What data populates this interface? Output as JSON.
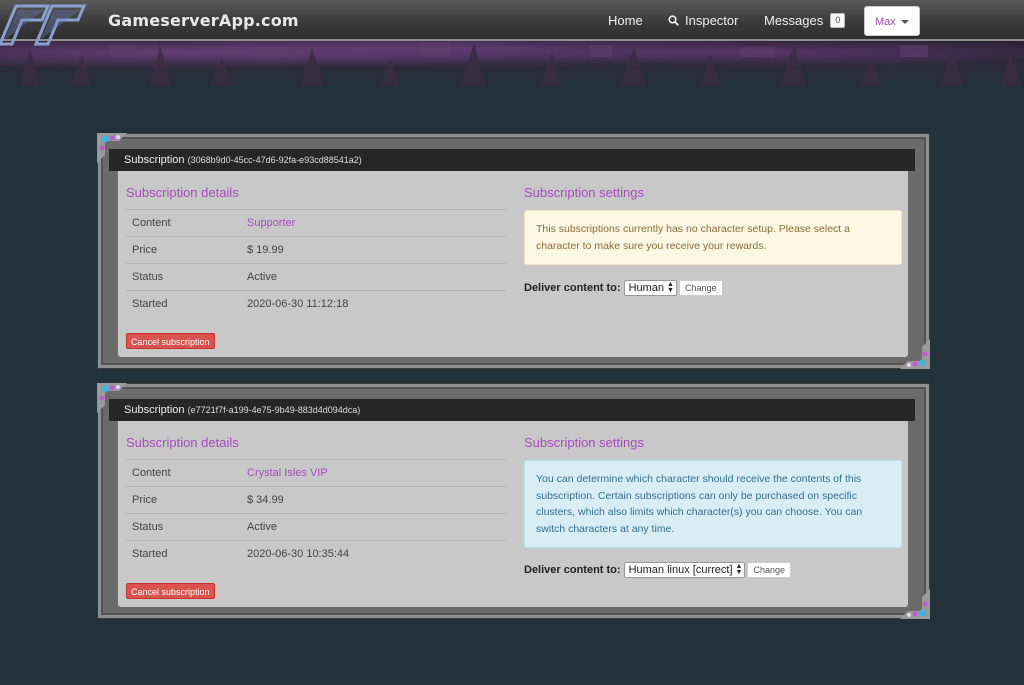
{
  "nav": {
    "brand": "GameserverApp.com",
    "home": "Home",
    "inspector": "Inspector",
    "messages": "Messages",
    "messages_count": "0",
    "user": "Max"
  },
  "subscriptions": [
    {
      "header_label": "Subscription",
      "id": "(3068b9d0-45cc-47d6-92fa-e93cd88541a2)",
      "details_title": "Subscription details",
      "settings_title": "Subscription settings",
      "rows": [
        {
          "key": "Content",
          "value": "Supporter"
        },
        {
          "key": "Price",
          "value": "$ 19.99"
        },
        {
          "key": "Status",
          "value": "Active"
        },
        {
          "key": "Started",
          "value": "2020-06-30 11:12:18"
        }
      ],
      "cancel_label": "Cancel subscription",
      "alert": "This subscriptions currently has no character setup. Please select a character to make sure you receive your rewards.",
      "deliver_label": "Deliver content to:",
      "deliver_value": "Human",
      "change_label": "Change"
    },
    {
      "header_label": "Subscription",
      "id": "(e7721f7f-a199-4e75-9b49-883d4d094dca)",
      "details_title": "Subscription details",
      "settings_title": "Subscription settings",
      "rows": [
        {
          "key": "Content",
          "value": "Crystal Isles VIP"
        },
        {
          "key": "Price",
          "value": "$ 34.99"
        },
        {
          "key": "Status",
          "value": "Active"
        },
        {
          "key": "Started",
          "value": "2020-06-30 10:35:44"
        }
      ],
      "cancel_label": "Cancel subscription",
      "alert": "You can determine which character should receive the contents of this subscription. Certain subscriptions can only be purchased on specific clusters, which also limits which character(s) you can choose. You can switch characters at any time.",
      "deliver_label": "Deliver content to:",
      "deliver_value": "Human linux [currect]",
      "change_label": "Change"
    }
  ],
  "colors": {
    "accent": "#a64bbd",
    "page_bg": "#22313a",
    "danger": "#d9534f",
    "warning_bg": "#fcf8e3",
    "info_bg": "#d9edf7"
  },
  "icons": [
    "logo-icon",
    "search-icon",
    "caret-down-icon",
    "gem-corner-icon"
  ]
}
